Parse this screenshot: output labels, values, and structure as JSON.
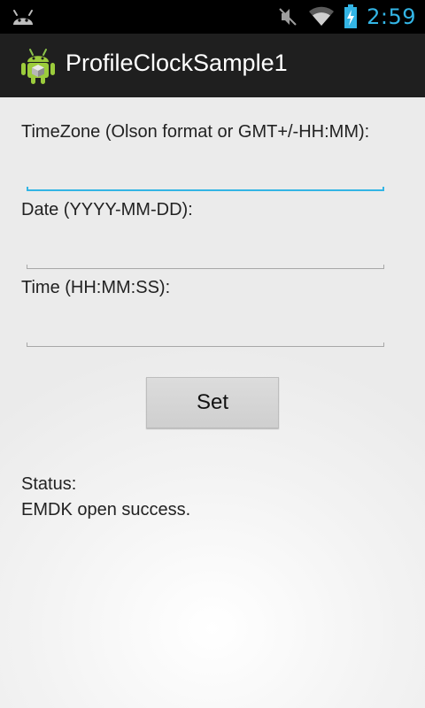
{
  "status_bar": {
    "time": "2:59",
    "icons": [
      "android-debug-icon",
      "vibrate-muted-icon",
      "wifi-icon",
      "battery-charging-icon"
    ]
  },
  "action_bar": {
    "title": "ProfileClockSample1",
    "icon": "android-app-icon"
  },
  "form": {
    "timezone_label": "TimeZone (Olson format or GMT+/-HH:MM):",
    "timezone_value": "",
    "date_label": "Date (YYYY-MM-DD):",
    "date_value": "",
    "time_label": "Time (HH:MM:SS):",
    "time_value": "",
    "set_button_label": "Set"
  },
  "status": {
    "label": "Status:",
    "message": "EMDK open success."
  },
  "colors": {
    "accent": "#33b5e5",
    "action_bar": "#1f1f1f",
    "status_bar": "#000000"
  }
}
